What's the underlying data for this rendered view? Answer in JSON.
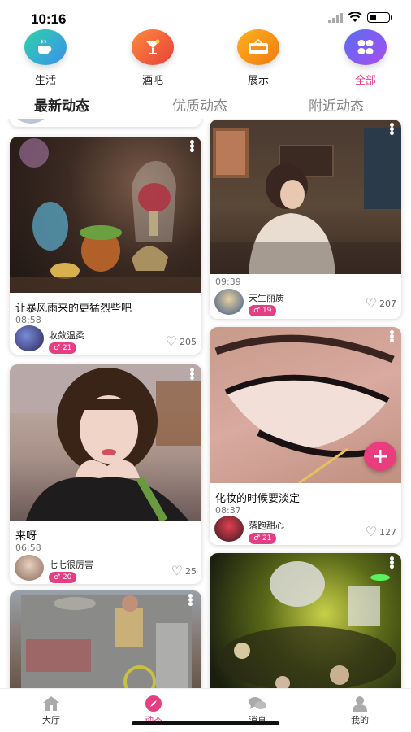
{
  "status": {
    "time": "10:16"
  },
  "categories": [
    {
      "label": "生活",
      "icon": "coffee-cup-icon",
      "color_from": "#2fd3a6",
      "color_to": "#3a8ff0",
      "active": false
    },
    {
      "label": "酒吧",
      "icon": "cocktail-glass-icon",
      "color_from": "#ff8a3d",
      "color_to": "#e8403a",
      "active": false
    },
    {
      "label": "展示",
      "icon": "show-sign-icon",
      "color_from": "#ffb020",
      "color_to": "#f07a10",
      "active": false
    },
    {
      "label": "全部",
      "icon": "grid-four-icon",
      "color_from": "#5a6cf0",
      "color_to": "#a64ef0",
      "active": true
    }
  ],
  "tabs": [
    {
      "label": "最新动态",
      "active": true
    },
    {
      "label": "优质动态",
      "active": false
    },
    {
      "label": "附近动态",
      "active": false
    }
  ],
  "posts": [
    {
      "title": "让暴风雨来的更猛烈些吧",
      "time": "08:58",
      "user": "收敛温柔",
      "badge": "21",
      "likes": "205"
    },
    {
      "title": "",
      "time": "09:39",
      "user": "天生丽质",
      "badge": "19",
      "likes": "207"
    },
    {
      "title": "化妆的时候要淡定",
      "time": "08:37",
      "user": "落跑甜心",
      "badge": "21",
      "likes": "127"
    },
    {
      "title": "来呀",
      "time": "06:58",
      "user": "七七很厉害",
      "badge": "20",
      "likes": "25"
    }
  ],
  "nav": [
    {
      "label": "大厅",
      "icon": "home-icon",
      "active": false
    },
    {
      "label": "动态",
      "icon": "compass-icon",
      "active": true
    },
    {
      "label": "消息",
      "icon": "chat-bubbles-icon",
      "active": false
    },
    {
      "label": "我的",
      "icon": "person-icon",
      "active": false
    }
  ],
  "colors": {
    "accent": "#e63e82",
    "text": "#222222",
    "muted": "#888888"
  }
}
